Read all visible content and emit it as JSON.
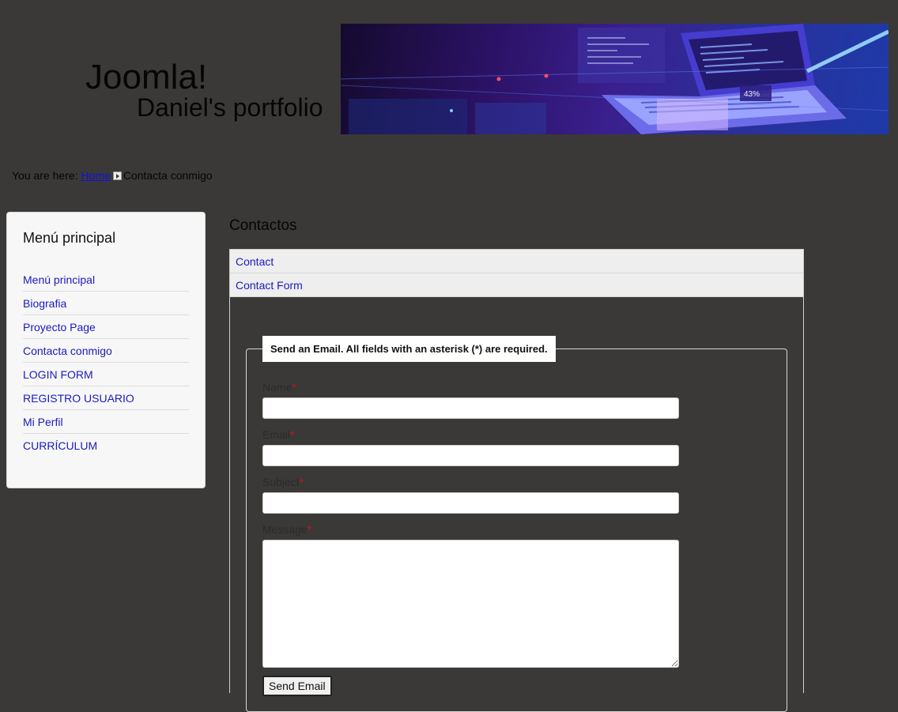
{
  "header": {
    "logo_title": "Joomla!",
    "logo_subtitle": "Daniel's portfolio",
    "banner_percent_label": "43%"
  },
  "breadcrumb": {
    "prefix": "You are here:",
    "home_label": "Home",
    "current": "Contacta conmigo"
  },
  "sidebar": {
    "title": "Menú principal",
    "items": [
      {
        "label": "Menú principal"
      },
      {
        "label": "Biografia"
      },
      {
        "label": "Proyecto Page"
      },
      {
        "label": "Contacta conmigo"
      },
      {
        "label": "LOGIN FORM"
      },
      {
        "label": "REGISTRO USUARIO"
      },
      {
        "label": "Mi Perfil"
      },
      {
        "label": "CURRÍCULUM"
      }
    ]
  },
  "main": {
    "title": "Contactos",
    "tabs": [
      {
        "label": "Contact"
      },
      {
        "label": "Contact Form"
      }
    ],
    "form": {
      "legend": "Send an Email. All fields with an asterisk (*) are required.",
      "required_mark": "*",
      "name_label": "Name",
      "email_label": "Email",
      "subject_label": "Subject",
      "message_label": "Message",
      "name_value": "",
      "email_value": "",
      "subject_value": "",
      "message_value": "",
      "submit_label": "Send Email"
    }
  },
  "colors": {
    "page_background": "#3b3937",
    "link": "#1a1ac0",
    "required_star": "#cc1111"
  }
}
